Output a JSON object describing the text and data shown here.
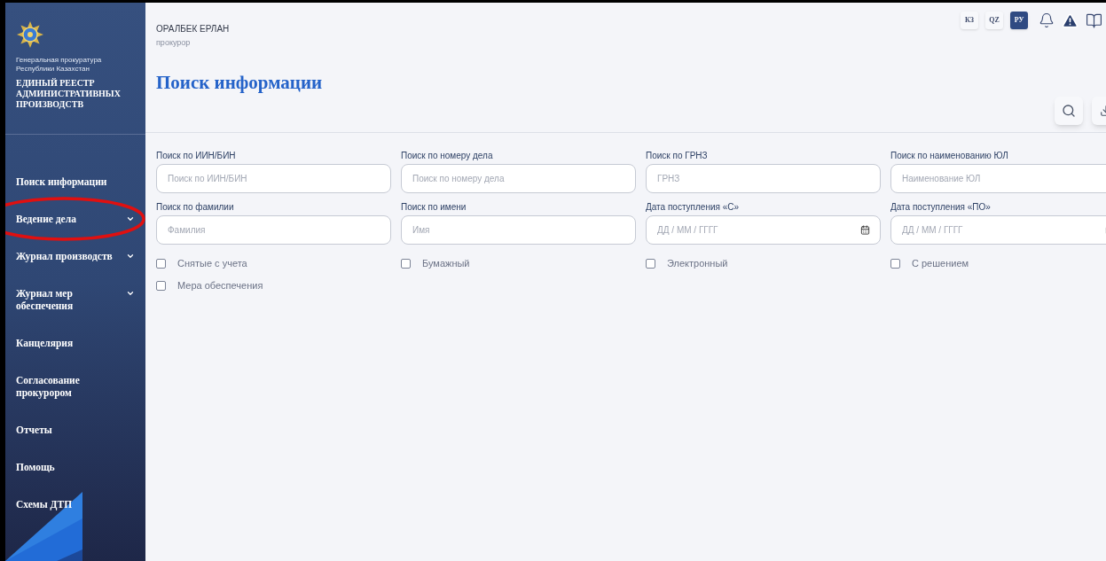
{
  "sidebar": {
    "org": "Генеральная прокуратура Республики Казахстан",
    "system": "ЕДИНЫЙ РЕЕСТР АДМИНИСТРАТИВНЫХ ПРОИЗВОДСТВ",
    "items": [
      {
        "label": "Поиск информации",
        "expandable": false
      },
      {
        "label": "Ведение дела",
        "expandable": true
      },
      {
        "label": "Журнал производств",
        "expandable": true
      },
      {
        "label": "Журнал мер обеспечения",
        "expandable": true
      },
      {
        "label": "Канцелярия",
        "expandable": false
      },
      {
        "label": "Согласование прокурором",
        "expandable": false
      },
      {
        "label": "Отчеты",
        "expandable": false
      },
      {
        "label": "Помощь",
        "expandable": false
      },
      {
        "label": "Схемы ДТП",
        "expandable": false
      }
    ]
  },
  "user": {
    "name": "ОРАЛБЕК ЕРЛАН",
    "role": "прокурор"
  },
  "languages": [
    {
      "label": "КЗ",
      "selected": false
    },
    {
      "label": "QZ",
      "selected": false
    },
    {
      "label": "РУ",
      "selected": true
    }
  ],
  "page_title": "Поиск информации",
  "fields": [
    {
      "label": "Поиск по ИИН/БИН",
      "placeholder": "Поиск по ИИН/БИН",
      "kind": "text"
    },
    {
      "label": "Поиск по номеру дела",
      "placeholder": "Поиск по номеру дела",
      "kind": "text"
    },
    {
      "label": "Поиск по ГРНЗ",
      "placeholder": "ГРНЗ",
      "kind": "text"
    },
    {
      "label": "Поиск по наименованию ЮЛ",
      "placeholder": "Наименование ЮЛ",
      "kind": "text"
    },
    {
      "label": "Поиск по фамилии",
      "placeholder": "Фамилия",
      "kind": "text"
    },
    {
      "label": "Поиск по имени",
      "placeholder": "Имя",
      "kind": "text"
    },
    {
      "label": "Дата поступления «С»",
      "placeholder": "ДД / ММ / ГГГГ",
      "kind": "date"
    },
    {
      "label": "Дата поступления «ПО»",
      "placeholder": "ДД / ММ / ГГГГ",
      "kind": "date"
    }
  ],
  "checkboxes": [
    {
      "label": "Снятые с учета",
      "checked": false
    },
    {
      "label": "Бумажный",
      "checked": false
    },
    {
      "label": "Электронный",
      "checked": false
    },
    {
      "label": "С решением",
      "checked": false
    },
    {
      "label": "Мера обеспечения",
      "checked": false
    }
  ]
}
